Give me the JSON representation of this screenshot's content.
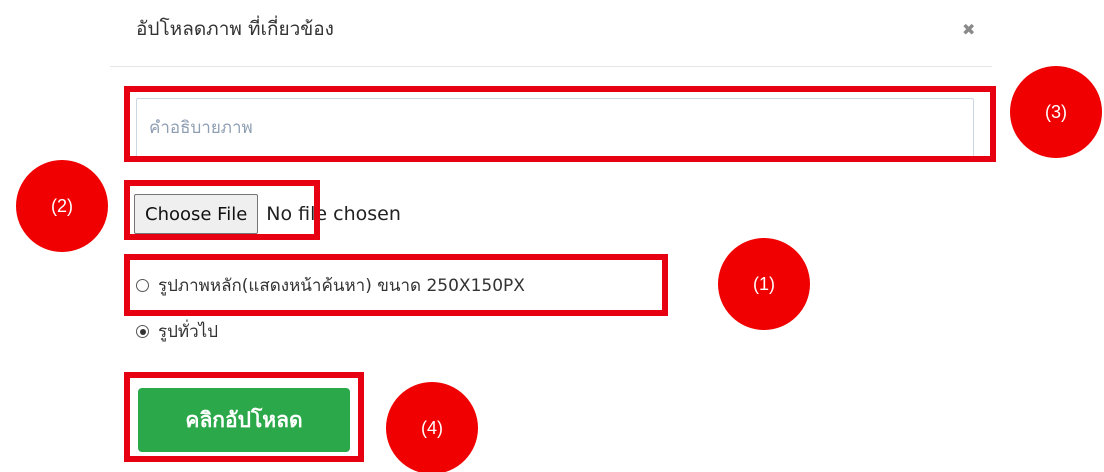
{
  "dialog": {
    "title": "อัปโหลดภาพ ที่เกี่ยวข้อง",
    "close_glyph": "✖"
  },
  "form": {
    "description": {
      "placeholder": "คำอธิบายภาพ",
      "value": ""
    },
    "file": {
      "button_label": "Choose File",
      "status": "No file chosen"
    },
    "image_type": {
      "options": [
        {
          "label": "รูปภาพหลัก(แสดงหน้าค้นหา) ขนาด 250X150PX",
          "checked": false
        },
        {
          "label": "รูปทั่วไป",
          "checked": true
        }
      ]
    },
    "submit_label": "คลิกอัปโหลด"
  },
  "annotations": {
    "highlight_color": "#e60012",
    "badge_color": "#f00000",
    "badges": [
      "(1)",
      "(2)",
      "(3)",
      "(4)"
    ]
  },
  "colors": {
    "upload_button": "#2aa84a",
    "input_border": "#cdd6e3",
    "placeholder": "#8f9fb3"
  },
  "icons": {
    "close": "close-icon",
    "radio": "radio-icon"
  }
}
